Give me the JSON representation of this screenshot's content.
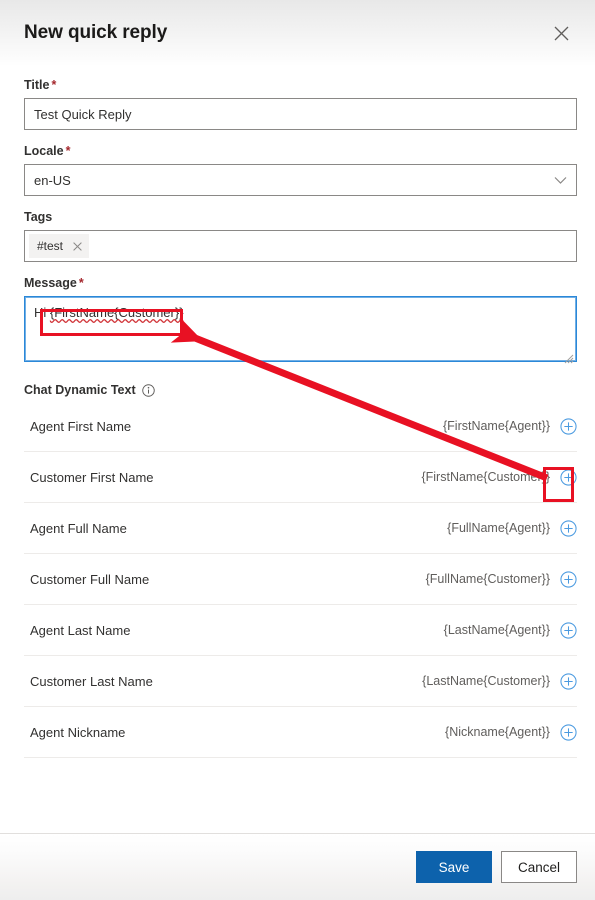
{
  "header": {
    "title": "New quick reply",
    "close_icon": "close-icon"
  },
  "form": {
    "title_field": {
      "label": "Title",
      "required_marker": "*",
      "value": "Test Quick Reply",
      "placeholder": ""
    },
    "locale_field": {
      "label": "Locale",
      "required_marker": "*",
      "value": "en-US",
      "chevron_icon": "chevron-down-icon"
    },
    "tags_field": {
      "label": "Tags",
      "tags": [
        {
          "text": "#test",
          "remove_icon": "close-icon"
        }
      ]
    },
    "message_field": {
      "label": "Message",
      "required_marker": "*",
      "value": "Hi {FirstName{Customer}}",
      "prefix_text": "Hi ",
      "token_text": "{FirstName{Customer}}"
    }
  },
  "dynamic_text": {
    "section_label": "Chat Dynamic Text",
    "info_icon": "info-icon",
    "rows": [
      {
        "name": "Agent First Name",
        "value": "{FirstName{Agent}}",
        "add_icon": "plus-circle-icon"
      },
      {
        "name": "Customer First Name",
        "value": "{FirstName{Customer}}",
        "add_icon": "plus-circle-icon"
      },
      {
        "name": "Agent Full Name",
        "value": "{FullName{Agent}}",
        "add_icon": "plus-circle-icon"
      },
      {
        "name": "Customer Full Name",
        "value": "{FullName{Customer}}",
        "add_icon": "plus-circle-icon"
      },
      {
        "name": "Agent Last Name",
        "value": "{LastName{Agent}}",
        "add_icon": "plus-circle-icon"
      },
      {
        "name": "Customer Last Name",
        "value": "{LastName{Customer}}",
        "add_icon": "plus-circle-icon"
      },
      {
        "name": "Agent Nickname",
        "value": "{Nickname{Agent}}",
        "add_icon": "plus-circle-icon"
      }
    ]
  },
  "footer": {
    "save_label": "Save",
    "cancel_label": "Cancel"
  },
  "annotation": {
    "color": "#e81123",
    "highlight_message_token": true,
    "highlight_add_button_row": "Customer First Name",
    "arrow_from": "Customer First Name add button",
    "arrow_to": "message token"
  },
  "colors": {
    "accent": "#0d62ac",
    "link": "#2b88d8",
    "required": "#a4262c",
    "annotation_red": "#e81123",
    "focus_border": "#2b88d8"
  }
}
